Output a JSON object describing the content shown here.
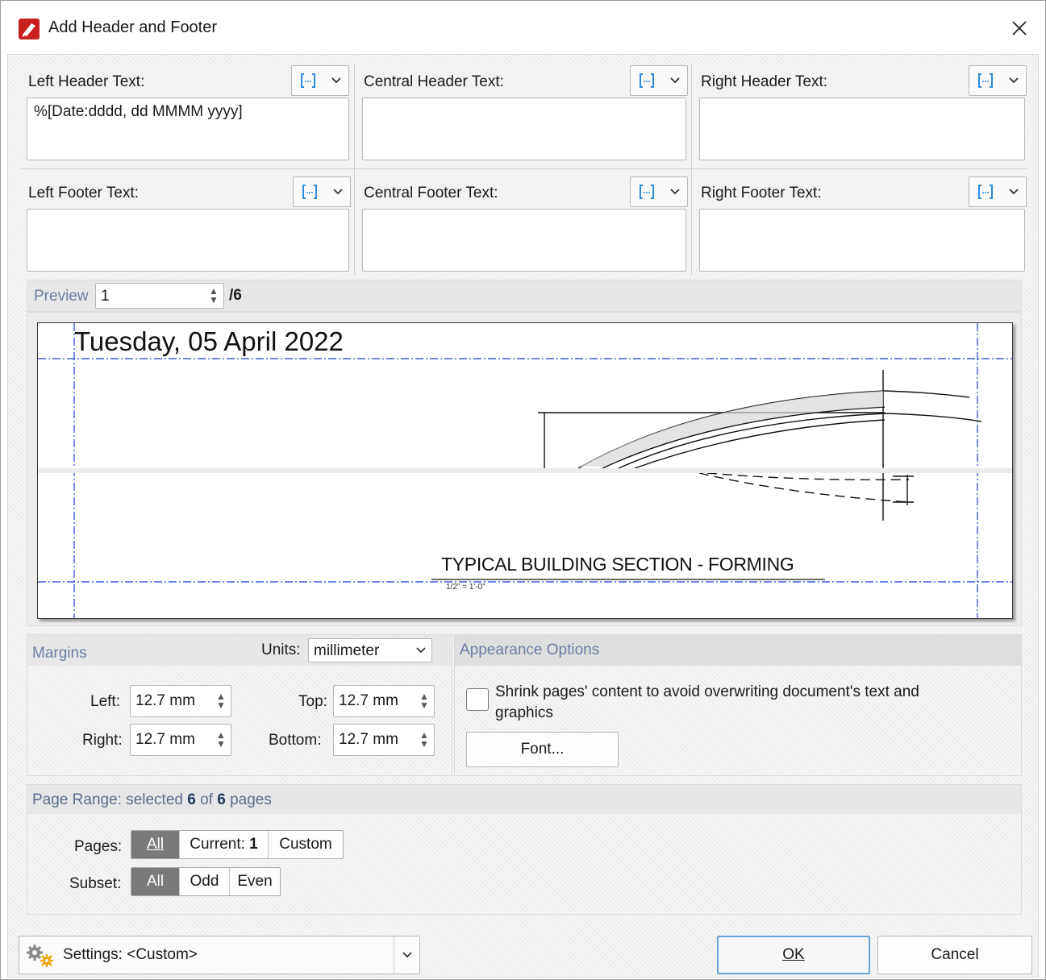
{
  "window": {
    "title": "Add Header and Footer"
  },
  "header": {
    "left_label": "Left Header Text:",
    "left_value": "%[Date:dddd, dd MMMM yyyy]",
    "central_label": "Central Header Text:",
    "central_value": "",
    "right_label": "Right Header Text:",
    "right_value": ""
  },
  "footer": {
    "left_label": "Left Footer Text:",
    "left_value": "",
    "central_label": "Central Footer Text:",
    "central_value": "",
    "right_label": "Right Footer Text:",
    "right_value": ""
  },
  "preview": {
    "label": "Preview",
    "page": "1",
    "total": "/6",
    "date_text": "Tuesday, 05 April 2022",
    "drawing_title": "TYPICAL BUILDING SECTION - FORMING",
    "drawing_scale": "1/2\" = 1'-0\""
  },
  "margins": {
    "title": "Margins",
    "units_label": "Units:",
    "units_value": "millimeter",
    "left_label": "Left:",
    "left_value": "12.7 mm",
    "top_label": "Top:",
    "top_value": "12.7 mm",
    "right_label": "Right:",
    "right_value": "12.7 mm",
    "bottom_label": "Bottom:",
    "bottom_value": "12.7 mm"
  },
  "appearance": {
    "title": "Appearance Options",
    "shrink_label_line1": "Shrink pages' content to avoid overwriting document's text and",
    "shrink_label_line2": "graphics",
    "shrink_checked": false,
    "font_button": "Font..."
  },
  "page_range": {
    "title_prefix": "Page Range: selected ",
    "selected": "6",
    "title_mid": " of ",
    "total": "6",
    "title_suffix": " pages",
    "pages_label": "Pages:",
    "pages_options": {
      "all": "All",
      "current_prefix": "Current: ",
      "current_value": "1",
      "custom": "Custom"
    },
    "pages_selected": "All",
    "subset_label": "Subset:",
    "subset_options": {
      "all": "All",
      "odd": "Odd",
      "even": "Even"
    },
    "subset_selected": "All"
  },
  "footer_bar": {
    "settings_label": "Settings:",
    "settings_value": "<Custom>",
    "ok": "OK",
    "cancel": "Cancel"
  },
  "colors": {
    "guide_line": "#1a3fd6",
    "group_title": "#6b7fa3",
    "selected_segment": "#7a7a7a",
    "ok_border": "#6aa2d8"
  }
}
